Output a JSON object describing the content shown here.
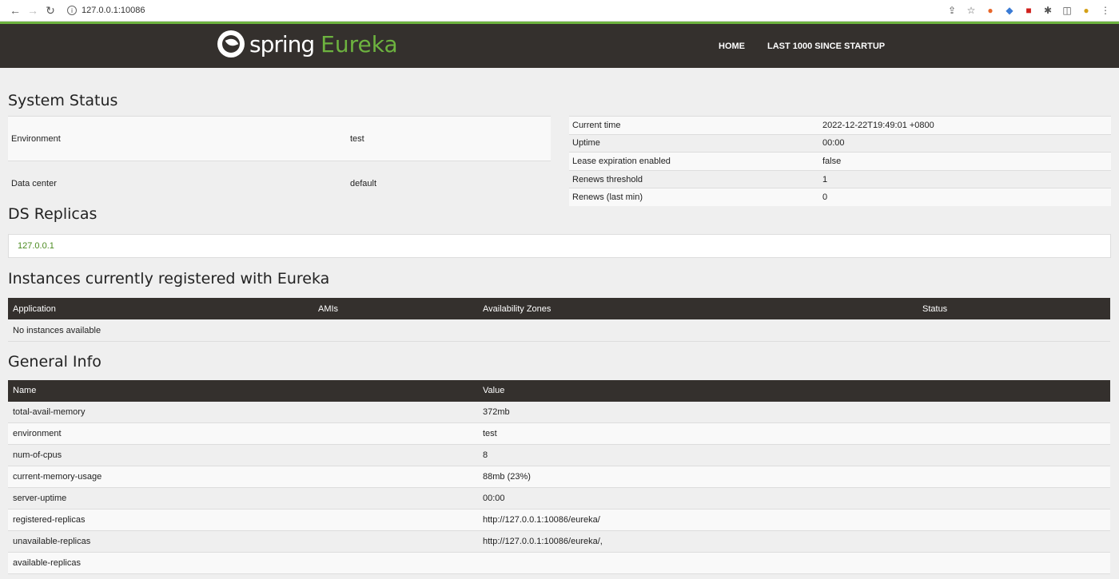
{
  "browser": {
    "url": "127.0.0.1:10086"
  },
  "header": {
    "logo_spring": "spring",
    "logo_eureka": "Eureka",
    "nav": [
      "HOME",
      "LAST 1000 SINCE STARTUP"
    ]
  },
  "system_status": {
    "title": "System Status",
    "left": [
      {
        "key": "Environment",
        "value": "test"
      },
      {
        "key": "Data center",
        "value": "default"
      }
    ],
    "right": [
      {
        "key": "Current time",
        "value": "2022-12-22T19:49:01 +0800"
      },
      {
        "key": "Uptime",
        "value": "00:00"
      },
      {
        "key": "Lease expiration enabled",
        "value": "false"
      },
      {
        "key": "Renews threshold",
        "value": "1"
      },
      {
        "key": "Renews (last min)",
        "value": "0"
      }
    ]
  },
  "ds_replicas": {
    "title": "DS Replicas",
    "items": [
      "127.0.0.1"
    ]
  },
  "instances": {
    "title": "Instances currently registered with Eureka",
    "columns": [
      "Application",
      "AMIs",
      "Availability Zones",
      "Status"
    ],
    "empty_text": "No instances available"
  },
  "general_info": {
    "title": "General Info",
    "columns": [
      "Name",
      "Value"
    ],
    "rows": [
      {
        "name": "total-avail-memory",
        "value": "372mb"
      },
      {
        "name": "environment",
        "value": "test"
      },
      {
        "name": "num-of-cpus",
        "value": "8"
      },
      {
        "name": "current-memory-usage",
        "value": "88mb (23%)"
      },
      {
        "name": "server-uptime",
        "value": "00:00"
      },
      {
        "name": "registered-replicas",
        "value": "http://127.0.0.1:10086/eureka/"
      },
      {
        "name": "unavailable-replicas",
        "value": "http://127.0.0.1:10086/eureka/,"
      },
      {
        "name": "available-replicas",
        "value": ""
      }
    ]
  }
}
